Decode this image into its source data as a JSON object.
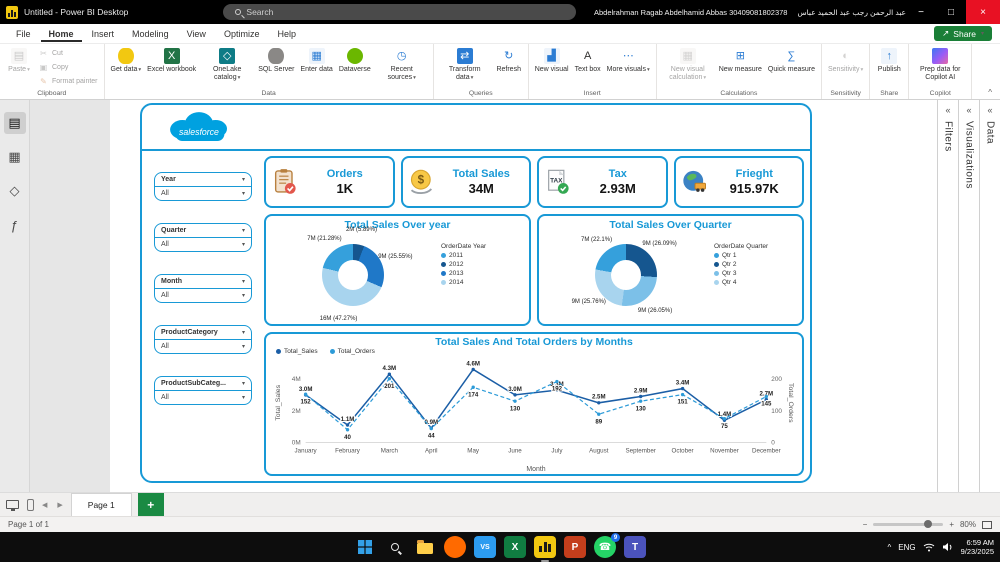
{
  "colors": {
    "accent": "#1899D6",
    "salesforce_blue": "#00A1E0",
    "powerbi_yellow": "#f2c811"
  },
  "glyphs": {
    "caret": "▾",
    "collapse": "«",
    "ribbon_collapse": "^",
    "nav_left": "◀",
    "nav_right": "▶",
    "minus": "−",
    "plus": "+",
    "share_arrow": "↗",
    "minimize": "−",
    "maximize": "□",
    "close": "×",
    "tray_chevron": "^"
  },
  "titlebar": {
    "title": "Untitled - Power BI Desktop",
    "search_placeholder": "Search",
    "user_en": "Abdelrahman Ragab Abdelhamid Abbas 30409081802378",
    "user_ar": "عبد الرحمن رجب عبد الحميد عباس"
  },
  "menubar": {
    "items": [
      "File",
      "Home",
      "Insert",
      "Modeling",
      "View",
      "Optimize",
      "Help"
    ],
    "active": "Home",
    "share_label": "Share"
  },
  "ribbon": {
    "groups": [
      {
        "label": "Clipboard",
        "big": [
          {
            "label": "Paste",
            "icon": "paste-icon",
            "glyph": "▤",
            "color": "#f1efed",
            "glyph_color": "#8a8886",
            "caret": true,
            "disabled": true
          }
        ],
        "small": [
          {
            "label": "Cut",
            "icon": "cut-icon",
            "glyph": "✂",
            "shape": "none",
            "glyph_color": "#8a8886",
            "disabled": true
          },
          {
            "label": "Copy",
            "icon": "copy-icon",
            "glyph": "▣",
            "shape": "none",
            "glyph_color": "#8a8886",
            "disabled": true
          },
          {
            "label": "Format painter",
            "icon": "format-painter-icon",
            "glyph": "✎",
            "shape": "none",
            "glyph_color": "#c87a3e",
            "disabled": true
          }
        ]
      },
      {
        "label": "Data",
        "big": [
          {
            "label": "Get data",
            "icon": "get-data-icon",
            "shape": "cylinder",
            "color": "#f2c811",
            "caret": true
          },
          {
            "label": "Excel workbook",
            "icon": "excel-workbook-icon",
            "glyph": "X",
            "color": "#217346",
            "glyph_color": "#ffffff"
          },
          {
            "label": "OneLake catalog",
            "icon": "onelake-catalog-icon",
            "glyph": "◇",
            "color": "#0e7c86",
            "glyph_color": "#ffffff",
            "caret": true
          },
          {
            "label": "SQL Server",
            "icon": "sql-server-icon",
            "shape": "cylinder",
            "color": "#8a8886"
          },
          {
            "label": "Enter data",
            "icon": "enter-data-icon",
            "glyph": "▦",
            "color": "#eef4fb",
            "glyph_color": "#2b7cd3"
          },
          {
            "label": "Dataverse",
            "icon": "dataverse-icon",
            "shape": "circle",
            "color": "#6bb700"
          },
          {
            "label": "Recent sources",
            "icon": "recent-sources-icon",
            "glyph": "◷",
            "shape": "none",
            "glyph_color": "#2b7cd3",
            "caret": true
          }
        ]
      },
      {
        "label": "Queries",
        "big": [
          {
            "label": "Transform data",
            "icon": "transform-data-icon",
            "glyph": "⇄",
            "color": "#2b7cd3",
            "glyph_color": "#ffffff",
            "caret": true
          },
          {
            "label": "Refresh",
            "icon": "refresh-icon",
            "glyph": "↻",
            "shape": "none",
            "glyph_color": "#2b7cd3"
          }
        ]
      },
      {
        "label": "Insert",
        "big": [
          {
            "label": "New visual",
            "icon": "new-visual-icon",
            "glyph": "▟",
            "color": "#eef4fb",
            "glyph_color": "#2b7cd3"
          },
          {
            "label": "Text box",
            "icon": "text-box-icon",
            "glyph": "A",
            "shape": "none",
            "glyph_color": "#323130"
          },
          {
            "label": "More visuals",
            "icon": "more-visuals-icon",
            "glyph": "⋯",
            "shape": "none",
            "glyph_color": "#2b7cd3",
            "caret": true
          }
        ]
      },
      {
        "label": "Calculations",
        "big": [
          {
            "label": "New visual calculation",
            "icon": "new-visual-calculation-icon",
            "glyph": "▦",
            "color": "#f1efed",
            "glyph_color": "#a19f9d",
            "disabled": true,
            "caret": true
          },
          {
            "label": "New measure",
            "icon": "new-measure-icon",
            "glyph": "⊞",
            "shape": "none",
            "glyph_color": "#2b7cd3"
          },
          {
            "label": "Quick measure",
            "icon": "quick-measure-icon",
            "glyph": "∑",
            "shape": "none",
            "glyph_color": "#2b7cd3"
          }
        ]
      },
      {
        "label": "Sensitivity",
        "big": [
          {
            "label": "Sensitivity",
            "icon": "sensitivity-icon",
            "glyph": "◐",
            "shape": "none",
            "glyph_color": "#a19f9d",
            "disabled": true,
            "caret": true
          }
        ]
      },
      {
        "label": "Share",
        "big": [
          {
            "label": "Publish",
            "icon": "publish-icon",
            "glyph": "↑",
            "color": "#eef4fb",
            "glyph_color": "#2b7cd3"
          }
        ]
      },
      {
        "label": "Copilot",
        "big": [
          {
            "label": "Prep data for Copilot AI",
            "icon": "copilot-icon",
            "shape": "copilot"
          }
        ]
      }
    ]
  },
  "left_rail": {
    "items": [
      {
        "name": "report-view-icon",
        "glyph": "▤",
        "active": true
      },
      {
        "name": "table-view-icon",
        "glyph": "▦",
        "active": false
      },
      {
        "name": "model-view-icon",
        "glyph": "◇",
        "active": false
      },
      {
        "name": "dax-query-view-icon",
        "glyph": "ƒ",
        "active": false
      }
    ]
  },
  "right_rail": {
    "panes": [
      {
        "label": "Filters"
      },
      {
        "label": "Visualizations"
      },
      {
        "label": "Data"
      }
    ]
  },
  "dashboard": {
    "logo_text": "salesforce",
    "slicers": [
      {
        "label": "Year",
        "value": "All"
      },
      {
        "label": "Quarter",
        "value": "All"
      },
      {
        "label": "Month",
        "value": "All"
      },
      {
        "label": "ProductCategory",
        "value": "All"
      },
      {
        "label": "ProductSubCateg...",
        "value": "All"
      }
    ],
    "kpis": [
      {
        "title": "Orders",
        "value": "1K",
        "icon": "orders-icon"
      },
      {
        "title": "Total Sales",
        "value": "34M",
        "icon": "total-sales-icon"
      },
      {
        "title": "Tax",
        "value": "2.93M",
        "icon": "tax-icon"
      },
      {
        "title": "Frieght",
        "value": "915.97K",
        "icon": "freight-icon"
      }
    ]
  },
  "chart_data": [
    {
      "type": "pie",
      "title": "Total Sales Over year",
      "legend_title": "OrderDate Year",
      "legend_position": "right",
      "segments": [
        {
          "label": "2012",
          "value_text": "2M (5.89%)",
          "pct": 5.89,
          "color": "#15568F"
        },
        {
          "label": "2013",
          "value_text": "9M (25.55%)",
          "pct": 25.55,
          "color": "#1F78C8"
        },
        {
          "label": "2014",
          "value_text": "16M (47.27%)",
          "pct": 47.27,
          "color": "#A8D4EE"
        },
        {
          "label": "2011",
          "value_text": "7M (21.28%)",
          "pct": 21.28,
          "color": "#35A0DC"
        }
      ],
      "legend": [
        {
          "label": "2011",
          "color": "#35A0DC"
        },
        {
          "label": "2012",
          "color": "#15568F"
        },
        {
          "label": "2013",
          "color": "#1F78C8"
        },
        {
          "label": "2014",
          "color": "#A8D4EE"
        }
      ]
    },
    {
      "type": "pie",
      "title": "Total Sales Over Quarter",
      "legend_title": "OrderDate Quarter",
      "legend_position": "right",
      "segments": [
        {
          "label": "Qtr 2",
          "value_text": "9M (26.09%)",
          "pct": 26.09,
          "color": "#15568F"
        },
        {
          "label": "Qtr 3",
          "value_text": "9M (26.05%)",
          "pct": 26.05,
          "color": "#7CC0E8"
        },
        {
          "label": "Qtr 4",
          "value_text": "9M (25.76%)",
          "pct": 25.76,
          "color": "#A8D4EE"
        },
        {
          "label": "Qtr 1",
          "value_text": "7M (22.1%)",
          "pct": 22.1,
          "color": "#35A0DC"
        }
      ],
      "legend": [
        {
          "label": "Qtr 1",
          "color": "#35A0DC"
        },
        {
          "label": "Qtr 2",
          "color": "#15568F"
        },
        {
          "label": "Qtr 3",
          "color": "#7CC0E8"
        },
        {
          "label": "Qtr 4",
          "color": "#A8D4EE"
        }
      ]
    },
    {
      "type": "line",
      "title": "Total Sales And Total Orders by Months",
      "categories": [
        "January",
        "February",
        "March",
        "April",
        "May",
        "June",
        "July",
        "August",
        "September",
        "October",
        "November",
        "December"
      ],
      "xlabel": "Month",
      "y_left": {
        "label": "Total_Sales",
        "ticks": [
          "0M",
          "2M",
          "4M"
        ],
        "tick_values": [
          0,
          2,
          4
        ],
        "max": 5
      },
      "y_right": {
        "label": "Total_Orders",
        "ticks": [
          "0",
          "100",
          "200"
        ],
        "tick_values": [
          0,
          100,
          200
        ],
        "max": 250
      },
      "grid": false,
      "legend_position": "top-left",
      "series": [
        {
          "name": "Total_Sales",
          "color": "#1B5EA6",
          "style": "solid",
          "values": [
            3.0,
            1.1,
            4.3,
            0.9,
            4.6,
            3.0,
            3.3,
            2.5,
            2.9,
            3.4,
            1.4,
            2.7
          ],
          "labels": [
            "3.0M",
            "1.1M",
            "4.3M",
            "0.9M",
            "4.6M",
            "3.0M",
            "3.3M",
            "2.5M",
            "2.9M",
            "3.4M",
            "1.4M",
            "2.7M"
          ]
        },
        {
          "name": "Total_Orders",
          "color": "#2D9BD8",
          "style": "dashed",
          "values": [
            152,
            40,
            201,
            44,
            174,
            130,
            192,
            89,
            130,
            151,
            75,
            145
          ],
          "labels": [
            "152",
            "40",
            "201",
            "44",
            "174",
            "130",
            "192",
            "89",
            "130",
            "151",
            "75",
            "145"
          ]
        }
      ]
    }
  ],
  "page_tabs": {
    "tabs": [
      "Page 1"
    ],
    "active": "Page 1",
    "add_label": "+"
  },
  "status_bar": {
    "page_info": "Page 1 of 1",
    "zoom": "80%"
  },
  "taskbar": {
    "icons": [
      {
        "name": "start-icon",
        "type": "start"
      },
      {
        "name": "search-icon",
        "type": "search"
      },
      {
        "name": "file-explorer-icon",
        "type": "folder"
      },
      {
        "name": "firefox-icon",
        "type": "letter",
        "shape": "circle",
        "color": "#ff6a00",
        "letter": ""
      },
      {
        "name": "vscode-icon",
        "type": "letter",
        "color": "#2c9cf0",
        "letter": "VS"
      },
      {
        "name": "excel-icon",
        "type": "letter",
        "color": "#107c41",
        "letter": "X"
      },
      {
        "name": "powerbi-icon",
        "type": "pbi",
        "active": true
      },
      {
        "name": "powerpoint-icon",
        "type": "letter",
        "color": "#c43e1c",
        "letter": "P"
      },
      {
        "name": "whatsapp-icon",
        "type": "letter",
        "shape": "circle",
        "color": "#25d366",
        "letter": "☎",
        "badge": "9"
      },
      {
        "name": "teams-icon",
        "type": "letter",
        "color": "#4b53bc",
        "letter": "T"
      }
    ],
    "tray": {
      "chevron": "^",
      "lang": "ENG",
      "time": "6:59 AM",
      "date": "9/23/2025"
    }
  }
}
